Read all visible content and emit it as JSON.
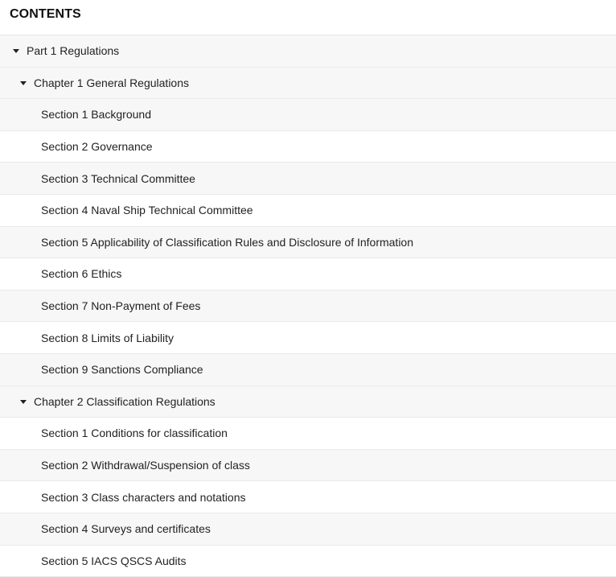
{
  "header": {
    "title": "CONTENTS"
  },
  "toc": {
    "part1": {
      "label": "Part 1 Regulations",
      "caret": "caret-down-icon"
    },
    "chapter1": {
      "label": "Chapter 1 General Regulations",
      "caret": "caret-down-icon",
      "sections": [
        {
          "label": "Section 1 Background"
        },
        {
          "label": "Section 2 Governance"
        },
        {
          "label": "Section 3 Technical Committee"
        },
        {
          "label": "Section 4 Naval Ship Technical Committee"
        },
        {
          "label": "Section 5 Applicability of Classification Rules and Disclosure of Information"
        },
        {
          "label": "Section 6 Ethics"
        },
        {
          "label": "Section 7 Non-Payment of Fees"
        },
        {
          "label": "Section 8 Limits of Liability"
        },
        {
          "label": "Section 9 Sanctions Compliance"
        }
      ]
    },
    "chapter2": {
      "label": "Chapter 2 Classification Regulations",
      "caret": "caret-down-icon",
      "sections": [
        {
          "label": "Section 1 Conditions for classification"
        },
        {
          "label": "Section 2 Withdrawal/Suspension of class"
        },
        {
          "label": "Section 3 Class characters and notations"
        },
        {
          "label": "Section 4 Surveys and certificates"
        },
        {
          "label": "Section 5 IACS QSCS Audits"
        }
      ]
    }
  },
  "colors": {
    "row_shade": "#f7f7f7",
    "row_plain": "#ffffff",
    "divider": "#e9e9e9",
    "text": "#222222"
  }
}
